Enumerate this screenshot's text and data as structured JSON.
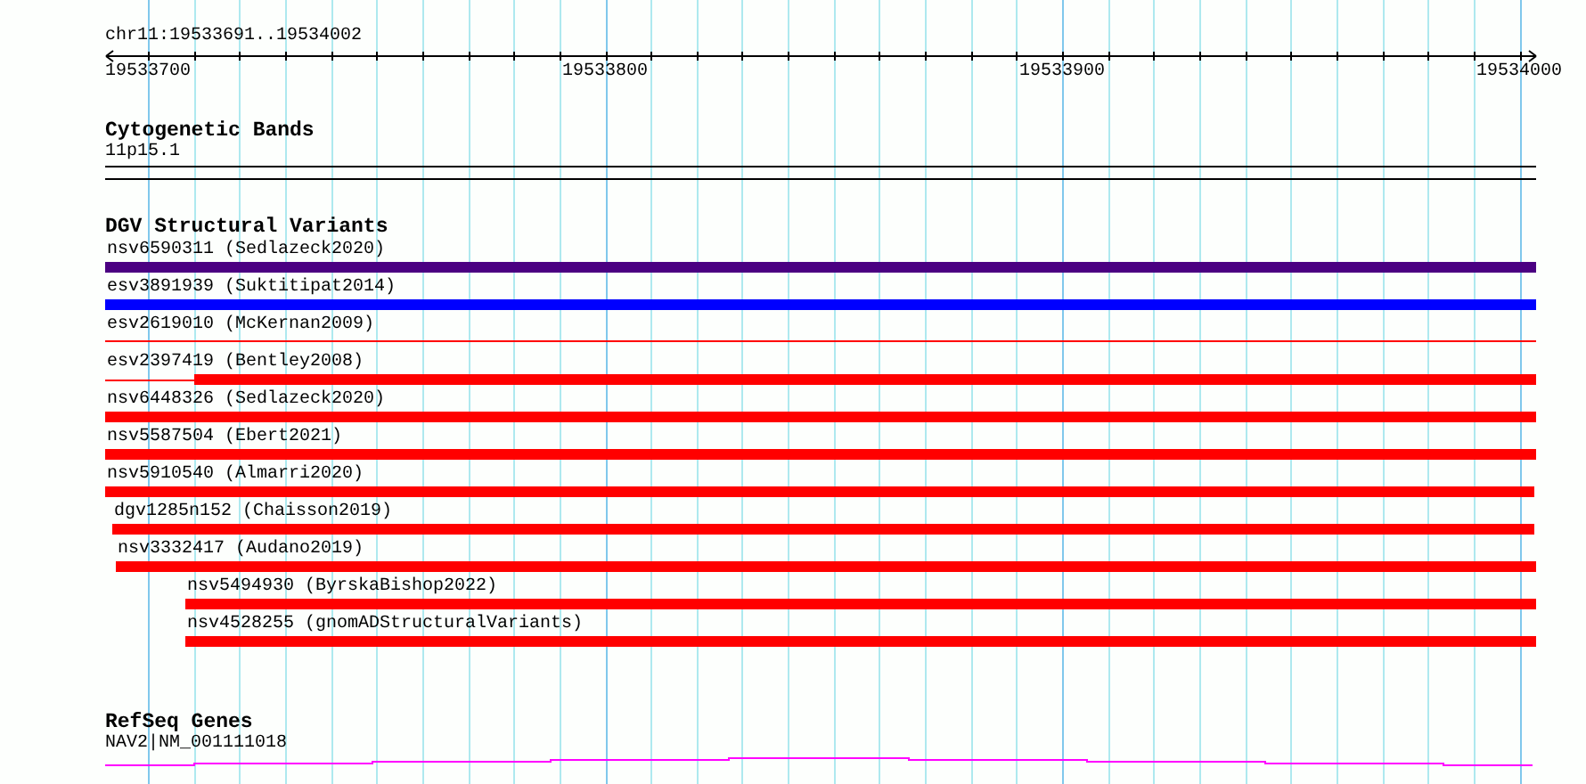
{
  "location": "chr11:19533691..19534002",
  "ruler": {
    "labels": [
      "19533700",
      "19533800",
      "19533900",
      "19534000"
    ]
  },
  "tracks": [
    {
      "kind": "bands",
      "title": "Cytogenetic Bands",
      "features": [
        {
          "label": "11p15.1"
        }
      ]
    },
    {
      "kind": "variants",
      "title": "DGV Structural Variants",
      "features": [
        {
          "label": "nsv6590311 (Sedlazeck2020)",
          "color": "#4b0082",
          "kind": "thick"
        },
        {
          "label": "esv3891939 (Suktitipat2014)",
          "color": "#0000ff",
          "kind": "thick"
        },
        {
          "label": "esv2619010 (McKernan2009)",
          "color": "#ff0000",
          "kind": "thin"
        },
        {
          "label": "esv2397419 (Bentley2008)",
          "color": "#ff0000",
          "kind": "partial"
        },
        {
          "label": "nsv6448326 (Sedlazeck2020)",
          "color": "#ff0000",
          "kind": "thick"
        },
        {
          "label": "nsv5587504 (Ebert2021)",
          "color": "#ff0000",
          "kind": "thick"
        },
        {
          "label": "nsv5910540 (Almarri2020)",
          "color": "#ff0000",
          "kind": "thick"
        },
        {
          "label": "dgv1285n152 (Chaisson2019)",
          "color": "#ff0000",
          "kind": "thick"
        },
        {
          "label": "nsv3332417 (Audano2019)",
          "color": "#ff0000",
          "kind": "thick"
        },
        {
          "label": "nsv5494930 (ByrskaBishop2022)",
          "color": "#ff0000",
          "kind": "thick"
        },
        {
          "label": "nsv4528255 (gnomADStructuralVariants)",
          "color": "#ff0000",
          "kind": "thick"
        }
      ]
    },
    {
      "kind": "genes",
      "title": "RefSeq Genes",
      "features": [
        {
          "label": "NAV2|NM_001111018"
        }
      ]
    }
  ]
}
